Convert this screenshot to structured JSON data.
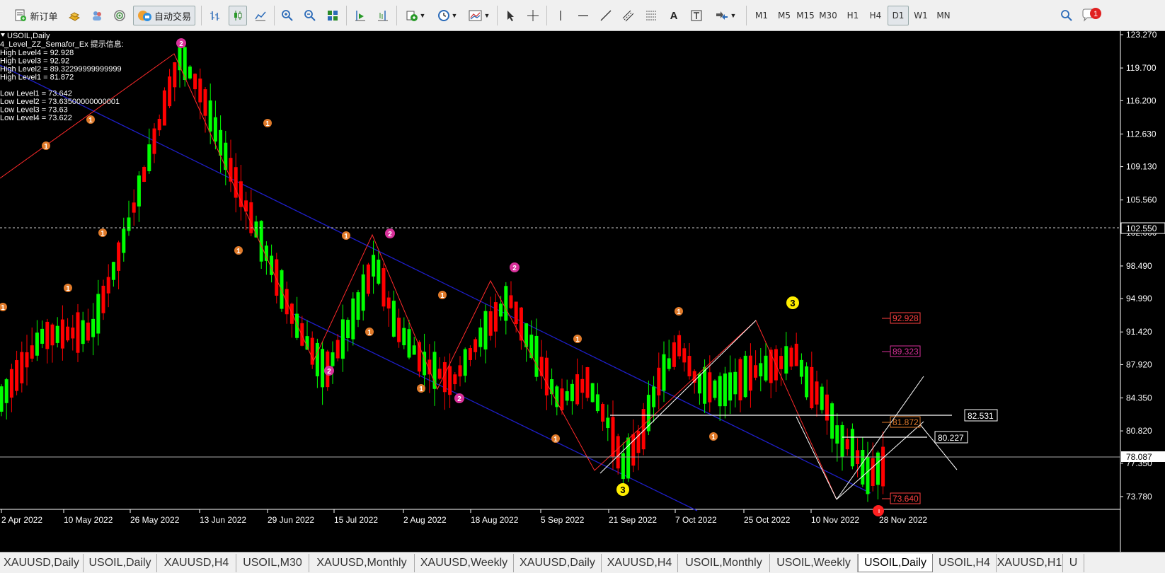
{
  "toolbar": {
    "new_order_label": "新订单",
    "auto_trade_label": "自动交易",
    "text_tool_label": "A",
    "timeframes": [
      "M1",
      "M5",
      "M15",
      "M30",
      "H1",
      "H4",
      "D1",
      "W1",
      "MN"
    ],
    "active_timeframe": "D1",
    "notification_count": "1"
  },
  "chart_info": {
    "symbol_line": "USOIL,Daily",
    "indicator_line": "4_Level_ZZ_Semafor_Ex 提示信息:",
    "levels": [
      "High Level4 = 92.928",
      "High Level3 = 92.92",
      "High Level2 = 89.32299999999999",
      "High Level1 = 81.872",
      "",
      "Low Level1 = 73.642",
      "Low Level2 = 73.63500000000001",
      "Low Level3 = 73.63",
      "Low Level4 = 73.622"
    ]
  },
  "price_axis": {
    "ticks": [
      "123.270",
      "119.700",
      "116.200",
      "112.630",
      "109.130",
      "105.560",
      "102.060",
      "98.490",
      "94.990",
      "91.420",
      "87.920",
      "84.350",
      "80.820",
      "77.350",
      "73.780"
    ],
    "current_price": "102.550",
    "bid_price": "78.087"
  },
  "date_axis": {
    "labels": [
      "2 Apr 2022",
      "10 May 2022",
      "26 May 2022",
      "13 Jun 2022",
      "29 Jun 2022",
      "15 Jul 2022",
      "2 Aug 2022",
      "18 Aug 2022",
      "5 Sep 2022",
      "21 Sep 2022",
      "7 Oct 2022",
      "25 Oct 2022",
      "10 Nov 2022",
      "28 Nov 2022"
    ]
  },
  "level_labels": {
    "high4": "92.928",
    "high2": "89.323",
    "high1": "81.872",
    "low": "73.640",
    "line_a": "82.531",
    "line_b": "80.227"
  },
  "semafor_labels": {
    "s1": "1",
    "s2": "2",
    "s3": "3"
  },
  "colors": {
    "bull": "#00ff00",
    "bear": "#ff0000",
    "channel": "#1e1ec8",
    "zigzag": "#ff2a2a",
    "semafor1": "#e07a2a",
    "semafor2": "#d8309a",
    "semafor3": "#ffee00"
  },
  "tabs": [
    "XAUUSD,Daily",
    "USOIL,Daily",
    "XAUUSD,H4",
    "USOIL,M30",
    "XAUUSD,Monthly",
    "XAUUSD,Weekly",
    "XAUUSD,Daily",
    "XAUUSD,H4",
    "USOIL,Monthly",
    "USOIL,Weekly",
    "USOIL,Daily",
    "USOIL,H4",
    "XAUUSD,H1",
    "U"
  ],
  "active_tab_index": 10
}
